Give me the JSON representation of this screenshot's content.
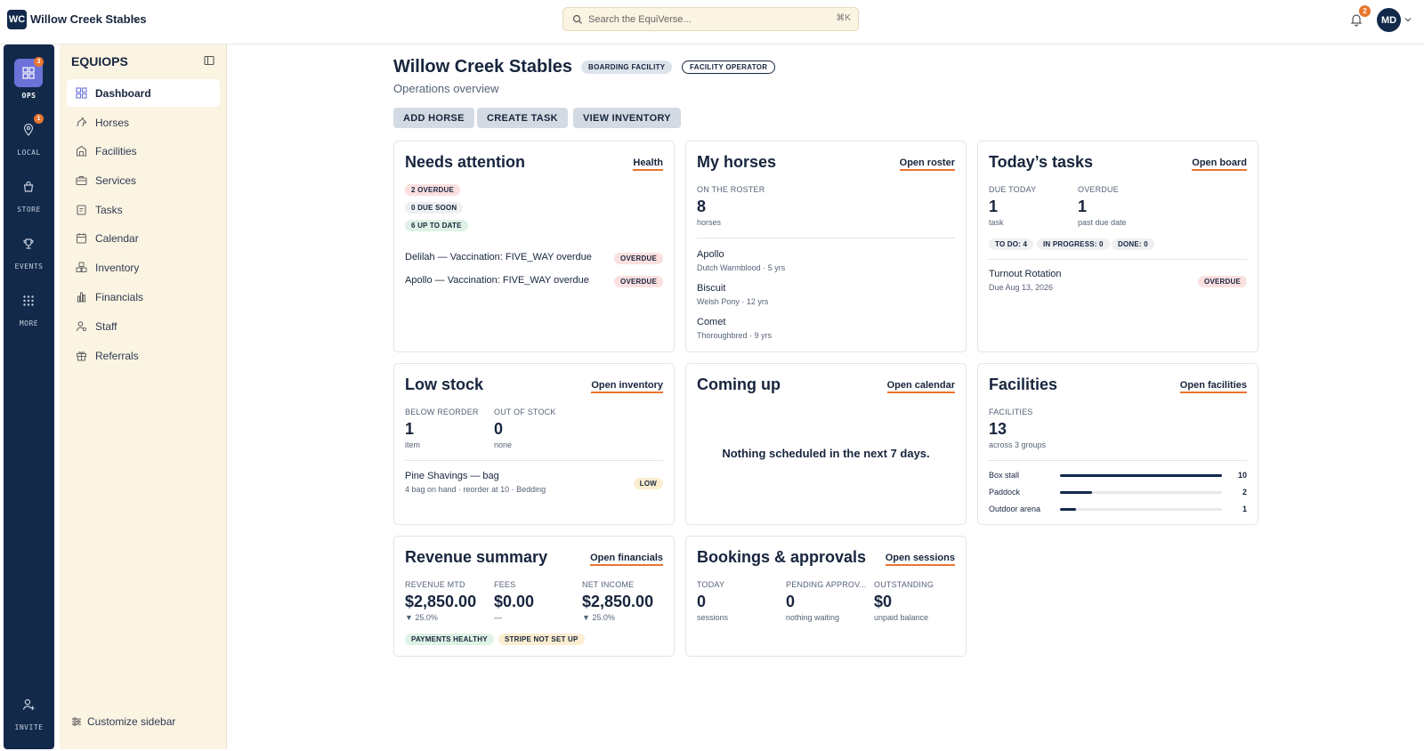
{
  "topbar": {
    "org_logo": "WC",
    "org_name": "Willow Creek Stables",
    "search_placeholder": "Search the EquiVerse...",
    "search_shortcut": "⌘K",
    "notification_count": "2",
    "user_initials": "MD"
  },
  "rail": {
    "items": [
      {
        "label": "OPS",
        "icon": "grid-icon",
        "badge": "3"
      },
      {
        "label": "LOCAL",
        "icon": "map-pin-icon",
        "badge": "1"
      },
      {
        "label": "STORE",
        "icon": "shopping-bag-icon"
      },
      {
        "label": "EVENTS",
        "icon": "trophy-icon"
      },
      {
        "label": "MORE",
        "icon": "dots-grid-icon"
      },
      {
        "label": "INVITE",
        "icon": "add-user-icon"
      }
    ]
  },
  "sidebar": {
    "title": "EQUIOPS",
    "items": [
      {
        "label": "Dashboard",
        "icon": "dashboard-icon"
      },
      {
        "label": "Horses",
        "icon": "horse-icon"
      },
      {
        "label": "Facilities",
        "icon": "building-icon"
      },
      {
        "label": "Services",
        "icon": "briefcase-icon"
      },
      {
        "label": "Tasks",
        "icon": "clipboard-icon"
      },
      {
        "label": "Calendar",
        "icon": "calendar-icon"
      },
      {
        "label": "Inventory",
        "icon": "boxes-icon"
      },
      {
        "label": "Financials",
        "icon": "bar-chart-icon"
      },
      {
        "label": "Staff",
        "icon": "user-gear-icon"
      },
      {
        "label": "Referrals",
        "icon": "gift-icon"
      }
    ],
    "customize_label": "Customize sidebar"
  },
  "header": {
    "title": "Willow Creek Stables",
    "tag_type": "BOARDING FACILITY",
    "tag_role": "FACILITY OPERATOR",
    "subtitle": "Operations overview",
    "actions": [
      "ADD HORSE",
      "CREATE TASK",
      "VIEW INVENTORY"
    ]
  },
  "needs_attention": {
    "title": "Needs attention",
    "link": "Health",
    "pill_overdue": "2 OVERDUE",
    "pill_due_soon": "0 DUE SOON",
    "pill_up_to_date": "6 UP TO DATE",
    "items": [
      {
        "text": "Delilah — Vaccination: FIVE_WAY overdue",
        "status": "OVERDUE"
      },
      {
        "text": "Apollo — Vaccination: FIVE_WAY overdue",
        "status": "OVERDUE"
      }
    ]
  },
  "my_horses": {
    "title": "My horses",
    "link": "Open roster",
    "stat_label": "ON THE ROSTER",
    "stat_value": "8",
    "stat_sub": "horses",
    "horses": [
      {
        "name": "Apollo",
        "detail": "Dutch Warmblood · 5 yrs"
      },
      {
        "name": "Biscuit",
        "detail": "Welsh Pony · 12 yrs"
      },
      {
        "name": "Comet",
        "detail": "Thoroughbred · 9 yrs"
      }
    ]
  },
  "todays_tasks": {
    "title": "Today’s tasks",
    "link": "Open board",
    "due_label": "DUE TODAY",
    "due_value": "1",
    "due_sub": "task",
    "overdue_label": "OVERDUE",
    "overdue_value": "1",
    "overdue_sub": "past due date",
    "pill_todo": "TO DO: 4",
    "pill_in_progress": "IN PROGRESS: 0",
    "pill_done": "DONE: 0",
    "task": {
      "name": "Turnout Rotation",
      "due": "Due Aug 13, 2026",
      "status": "OVERDUE"
    }
  },
  "low_stock": {
    "title": "Low stock",
    "link": "Open inventory",
    "below_label": "BELOW REORDER",
    "below_value": "1",
    "below_sub": "item",
    "out_label": "OUT OF STOCK",
    "out_value": "0",
    "out_sub": "none",
    "item": {
      "name": "Pine Shavings — bag",
      "detail": "4 bag on hand · reorder at 10 · Bedding",
      "status": "LOW"
    }
  },
  "coming_up": {
    "title": "Coming up",
    "link": "Open calendar",
    "empty": "Nothing scheduled in the next 7 days."
  },
  "facilities": {
    "title": "Facilities",
    "link": "Open facilities",
    "stat_label": "FACILITIES",
    "stat_value": "13",
    "stat_sub": "across 3 groups",
    "groups": [
      {
        "name": "Box stall",
        "count": 10
      },
      {
        "name": "Paddock",
        "count": 2
      },
      {
        "name": "Outdoor arena",
        "count": 1
      }
    ]
  },
  "revenue": {
    "title": "Revenue summary",
    "link": "Open financials",
    "revenue_label": "REVENUE MTD",
    "revenue_value": "$2,850.00",
    "revenue_change": "▼ 25.0%",
    "fees_label": "FEES",
    "fees_value": "$0.00",
    "fees_change": "—",
    "net_label": "NET INCOME",
    "net_value": "$2,850.00",
    "net_change": "▼ 25.0%",
    "pill_payments": "PAYMENTS HEALTHY",
    "pill_stripe": "STRIPE NOT SET UP"
  },
  "bookings": {
    "title": "Bookings & approvals",
    "link": "Open sessions",
    "today_label": "TODAY",
    "today_value": "0",
    "today_sub": "sessions",
    "pending_label": "PENDING APPROV...",
    "pending_value": "0",
    "pending_sub": "nothing waiting",
    "outstanding_label": "OUTSTANDING",
    "outstanding_value": "$0",
    "outstanding_sub": "unpaid balance"
  },
  "colors": {
    "navy": "#12294a",
    "accent_orange": "#e8752f",
    "rail_active": "#6c72d8",
    "sidebar_bg": "#fbf4e3"
  }
}
